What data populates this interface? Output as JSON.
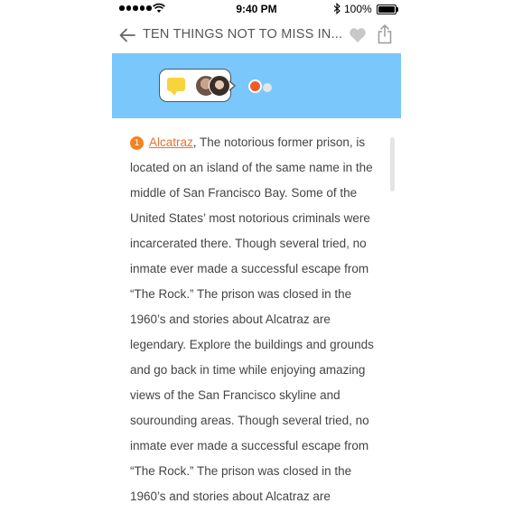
{
  "status_bar": {
    "time": "9:40 PM",
    "battery_percent": "100%"
  },
  "nav": {
    "title": "TEN THINGS NOT TO MISS IN..."
  },
  "banner": {
    "color": "#79c7fb"
  },
  "article": {
    "item_number": "1",
    "link_text": "Alcatraz",
    "body": ", The notorious former prison, is located on an island of the same name in the middle of San Francisco Bay. Some of the United States’ most notorious criminals were incarcerated there. Though several tried, no inmate ever made a successful escape from “The Rock.” The prison was closed in the 1960’s and stories about Alcatraz are legendary. Explore the buildings and grounds and go back in time while enjoying amazing views of the San Francisco skyline and sourounding areas. Though several tried, no inmate ever made a successful escape from “The Rock.” The prison was closed in the 1960’s and stories about Alcatraz are"
  },
  "colors": {
    "accent": "#f5821f",
    "link": "#e8722c"
  }
}
